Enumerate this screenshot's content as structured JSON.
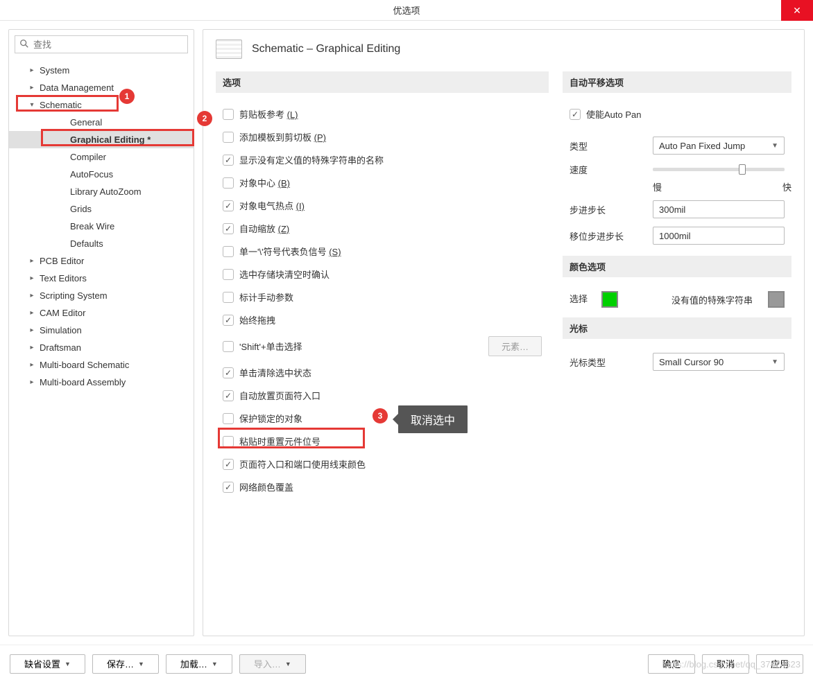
{
  "title": "优选项",
  "search_placeholder": "查找",
  "tree": {
    "system": "System",
    "data_management": "Data Management",
    "schematic": "Schematic",
    "schematic_children": {
      "general": "General",
      "graphical_editing": "Graphical Editing *",
      "compiler": "Compiler",
      "autofocus": "AutoFocus",
      "library_autozoom": "Library AutoZoom",
      "grids": "Grids",
      "break_wire": "Break Wire",
      "defaults": "Defaults"
    },
    "pcb_editor": "PCB Editor",
    "text_editors": "Text Editors",
    "scripting_system": "Scripting System",
    "cam_editor": "CAM Editor",
    "simulation": "Simulation",
    "draftsman": "Draftsman",
    "multiboard_schematic": "Multi-board Schematic",
    "multiboard_assembly": "Multi-board Assembly"
  },
  "page_heading": "Schematic – Graphical Editing",
  "sections": {
    "options": "选项",
    "auto_pan": "自动平移选项",
    "color": "颜色选项",
    "cursor": "光标"
  },
  "options": {
    "clipboard_ref": {
      "label": "剪贴板参考 ",
      "key": "(L)",
      "checked": false
    },
    "add_template": {
      "label": "添加模板到剪切板 ",
      "key": "(P)",
      "checked": false
    },
    "show_special": {
      "label": "显示没有定义值的特殊字符串的名称",
      "checked": true
    },
    "object_center": {
      "label": "对象中心 ",
      "key": "(B)",
      "checked": false
    },
    "electrical_hotspot": {
      "label": "对象电气热点 ",
      "key": "(I)",
      "checked": true
    },
    "auto_zoom": {
      "label": "自动缩放 ",
      "key": "(Z)",
      "checked": true
    },
    "single_neg": {
      "label": "单一'\\'符号代表负信号 ",
      "key": "(S)",
      "checked": false
    },
    "confirm_clear": {
      "label": "选中存储块清空时确认",
      "checked": false
    },
    "mark_manual": {
      "label": "标计手动参数",
      "checked": false
    },
    "always_drag": {
      "label": "始终拖拽",
      "checked": true
    },
    "shift_click": {
      "label": "'Shift'+单击选择",
      "checked": false
    },
    "click_clear": {
      "label": "单击清除选中状态",
      "checked": true
    },
    "auto_place_sheet": {
      "label": "自动放置页面符入口",
      "checked": true
    },
    "protect_locked": {
      "label": "保护锁定的对象",
      "checked": false
    },
    "reset_designator": {
      "label": "粘贴时重置元件位号",
      "checked": false
    },
    "sheet_port_color": {
      "label": "页面符入口和端口使用线束颜色",
      "checked": true
    },
    "net_color_override": {
      "label": "网络颜色覆盖",
      "checked": true
    }
  },
  "elements_btn": "元素…",
  "auto_pan": {
    "enable_label": "使能Auto Pan",
    "enable_checked": true,
    "type_label": "类型",
    "type_value": "Auto Pan Fixed Jump",
    "speed_label": "速度",
    "slow": "慢",
    "fast": "快",
    "step_label": "步进步长",
    "step_value": "300mil",
    "shift_step_label": "移位步进步长",
    "shift_step_value": "1000mil"
  },
  "color": {
    "select_label": "选择",
    "special_label": "没有值的特殊字符串"
  },
  "cursor": {
    "type_label": "光标类型",
    "type_value": "Small Cursor 90"
  },
  "buttons": {
    "defaults": "缺省设置",
    "save": "保存…",
    "load": "加载…",
    "import": "导入…",
    "ok": "确定",
    "cancel": "取消",
    "apply": "应用"
  },
  "anno": {
    "b1": "1",
    "b2": "2",
    "b3": "3",
    "tooltip": "取消选中"
  },
  "watermark": "https://blog.csdn.net/qq_37424623"
}
